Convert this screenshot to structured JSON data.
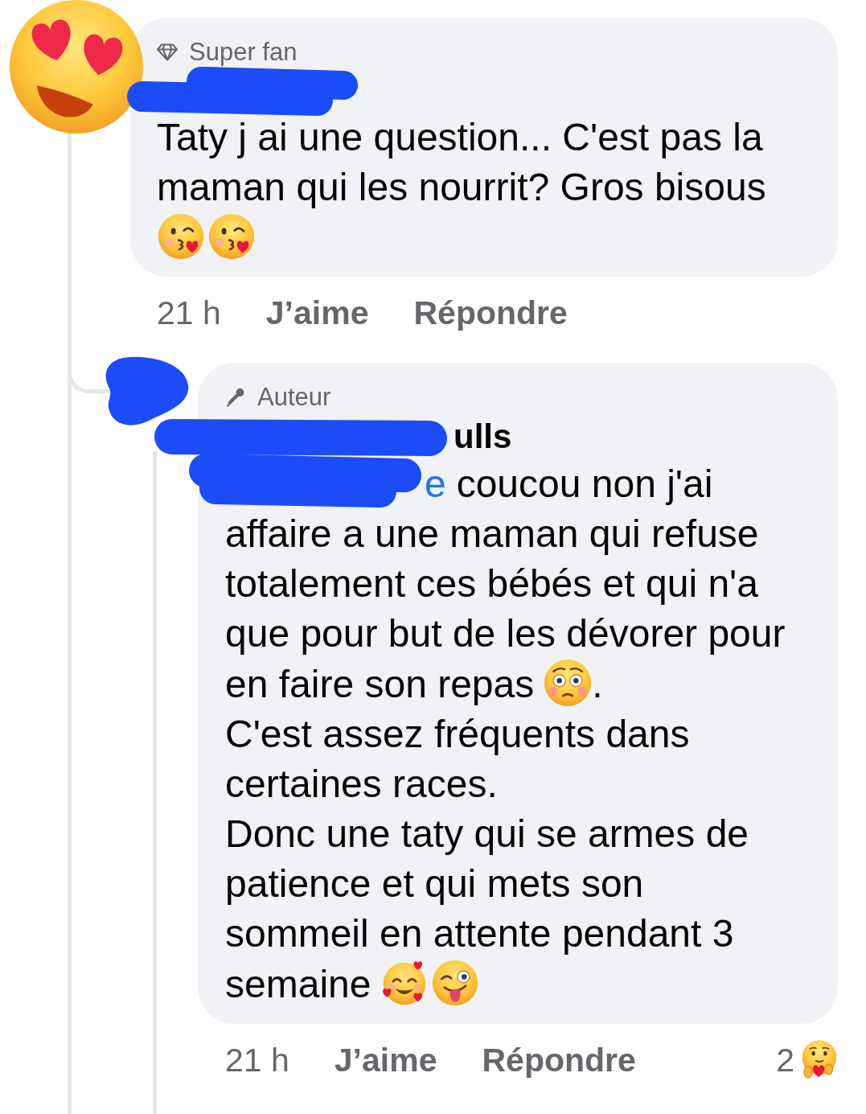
{
  "comments": [
    {
      "avatar_redacted": false,
      "badge": {
        "kind": "superfan",
        "label": "Super fan"
      },
      "name_redacted": true,
      "body": [
        [
          {
            "kind": "text",
            "text": "Taty j ai une question... C'est pas la maman qui les nourrit? Gros bisous"
          }
        ],
        [
          {
            "kind": "kiss"
          },
          {
            "kind": "kiss"
          }
        ]
      ],
      "time": "21 h",
      "like": "J’aime",
      "reply": "Répondre",
      "replies": [
        {
          "avatar_redacted": true,
          "badge": {
            "kind": "author",
            "label": "Auteur"
          },
          "name_redacted": true,
          "name": "ulls",
          "body": [
            [
              {
                "kind": "mention",
                "text": "e",
                "redacted": true
              },
              {
                "kind": "text",
                "text": "coucou non j'ai"
              }
            ],
            [
              {
                "kind": "text",
                "text": "affaire a une maman qui refuse totalement ces bébés et qui n'a que pour but de les dévorer pour"
              }
            ],
            [
              {
                "kind": "text",
                "text": "en faire son repas"
              },
              {
                "kind": "flushed"
              },
              {
                "kind": "text",
                "text": "."
              }
            ],
            [
              {
                "kind": "text",
                "text": "C'est assez fréquents dans certaines races."
              }
            ],
            [
              {
                "kind": "text",
                "text": "Donc une taty qui se armes de patience et qui mets son sommeil en attente pendant 3"
              }
            ],
            [
              {
                "kind": "text",
                "text": "semaine"
              },
              {
                "kind": "hearts"
              },
              {
                "kind": "wink"
              }
            ]
          ],
          "time": "21 h",
          "like": "J’aime",
          "reply": "Répondre",
          "reactions": {
            "count": "2"
          }
        }
      ]
    }
  ]
}
